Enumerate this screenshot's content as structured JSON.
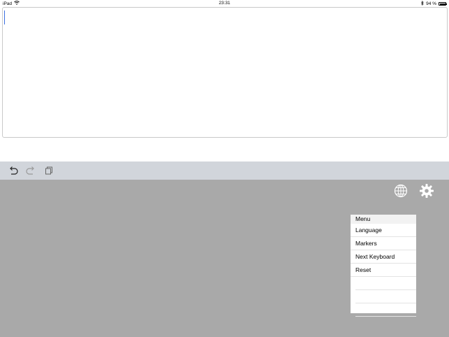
{
  "status_bar": {
    "device": "iPad",
    "time": "23:31",
    "battery": "94 %",
    "battery_level": 0.94,
    "icons": [
      "wifi-icon",
      "bluetooth-icon",
      "battery-icon"
    ]
  },
  "editor": {
    "value": ""
  },
  "toolbar": {
    "buttons": [
      "undo-icon",
      "redo-icon",
      "paste-icon"
    ]
  },
  "keyboard": {
    "icons": [
      "globe-icon",
      "gear-icon"
    ]
  },
  "menu": {
    "title": "Menu",
    "items": [
      "Language",
      "Markers",
      "Next Keyboard",
      "Reset"
    ]
  },
  "colors": {
    "keyboard_bg": "#a9a9a9",
    "toolbar_bg": "#d1d5db",
    "caret": "#3b6fe0"
  }
}
